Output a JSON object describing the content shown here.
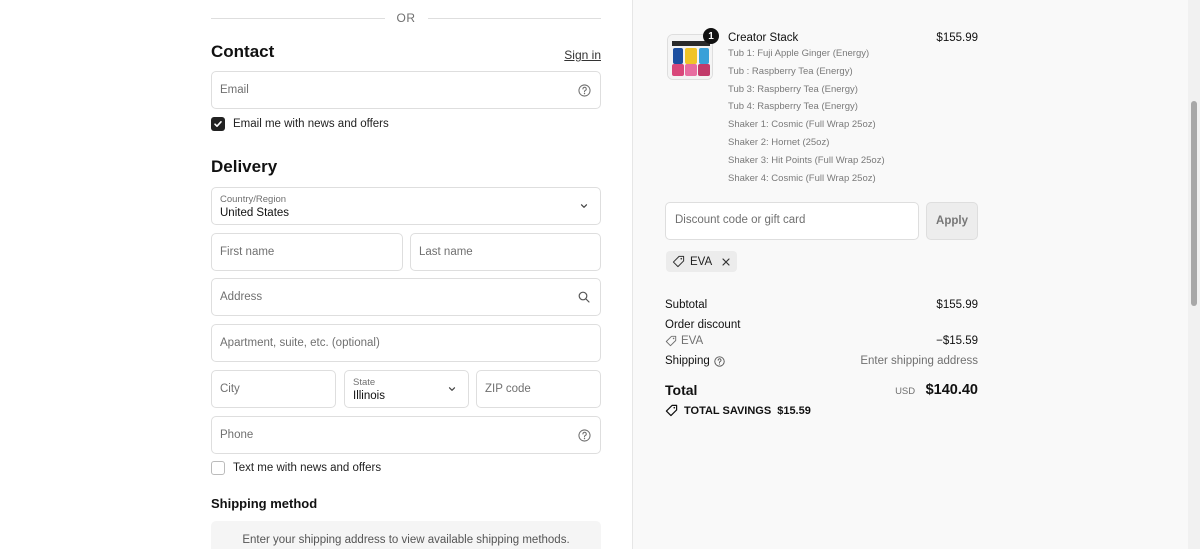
{
  "divider": {
    "text": "OR"
  },
  "contact": {
    "heading": "Contact",
    "sign_in": "Sign in",
    "email_placeholder": "Email",
    "newsletter_label": "Email me with news and offers",
    "newsletter_checked": true
  },
  "delivery": {
    "heading": "Delivery",
    "country_label": "Country/Region",
    "country_value": "United States",
    "first_name_placeholder": "First name",
    "last_name_placeholder": "Last name",
    "address_placeholder": "Address",
    "apartment_placeholder": "Apartment, suite, etc. (optional)",
    "city_placeholder": "City",
    "state_label": "State",
    "state_value": "Illinois",
    "zip_placeholder": "ZIP code",
    "phone_placeholder": "Phone",
    "sms_label": "Text me with news and offers",
    "sms_checked": false
  },
  "shipping_method": {
    "heading": "Shipping method",
    "message": "Enter your shipping address to view available shipping methods."
  },
  "cart": {
    "item": {
      "quantity": "1",
      "name": "Creator Stack",
      "price": "$155.99",
      "options": [
        "Tub 1: Fuji Apple Ginger (Energy)",
        "Tub : Raspberry Tea (Energy)",
        "Tub 3: Raspberry Tea (Energy)",
        "Tub 4: Raspberry Tea (Energy)",
        "Shaker 1: Cosmic (Full Wrap 25oz)",
        "Shaker 2: Hornet (25oz)",
        "Shaker 3: Hit Points (Full Wrap 25oz)",
        "Shaker 4: Cosmic (Full Wrap 25oz)"
      ]
    },
    "discount_placeholder": "Discount code or gift card",
    "apply_label": "Apply",
    "applied_code": "EVA",
    "summary": {
      "subtotal_label": "Subtotal",
      "subtotal_value": "$155.99",
      "order_discount_label": "Order discount",
      "discount_code": "EVA",
      "discount_value": "−$15.59",
      "shipping_label": "Shipping",
      "shipping_value": "Enter shipping address",
      "total_label": "Total",
      "currency": "USD",
      "total_value": "$140.40",
      "savings_label": "TOTAL SAVINGS",
      "savings_value": "$15.59"
    }
  },
  "colors": {
    "checkbox_on": "#222222",
    "panel_bg": "#f9f9f9",
    "border": "#dedede"
  }
}
